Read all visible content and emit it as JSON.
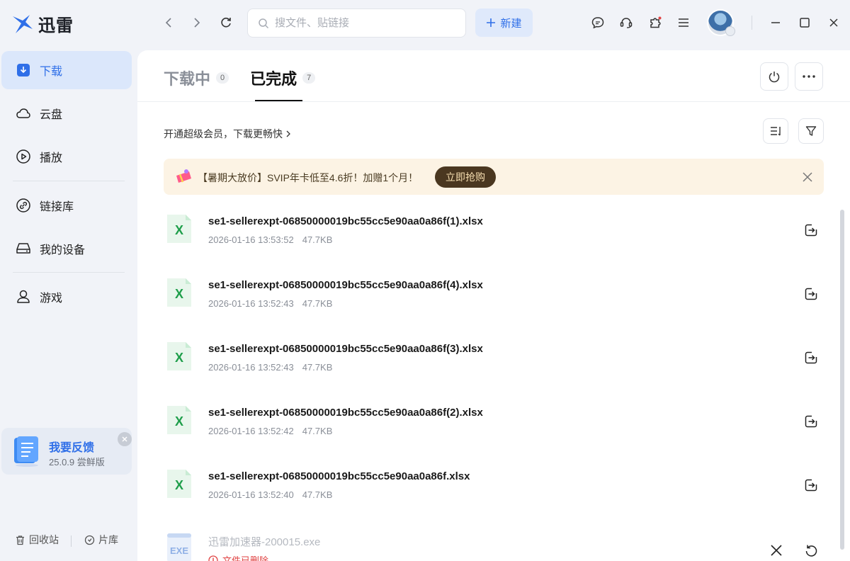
{
  "app": {
    "name": "迅雷"
  },
  "search": {
    "placeholder": "搜文件、贴链接"
  },
  "toolbar": {
    "new_label": "新建"
  },
  "sidebar": {
    "items": [
      {
        "label": "下载",
        "icon": "download-icon",
        "active": true
      },
      {
        "label": "云盘",
        "icon": "cloud-icon"
      },
      {
        "label": "播放",
        "icon": "play-icon"
      },
      {
        "label": "链接库",
        "icon": "link-icon"
      },
      {
        "label": "我的设备",
        "icon": "device-icon"
      },
      {
        "label": "游戏",
        "icon": "game-icon"
      }
    ],
    "feedback": {
      "title": "我要反馈",
      "version": "25.0.9 尝鲜版"
    },
    "bottom": {
      "recycle": "回收站",
      "library": "片库"
    }
  },
  "tabs": [
    {
      "label": "下载中",
      "count": "0"
    },
    {
      "label": "已完成",
      "count": "7",
      "active": true
    }
  ],
  "vip_link": "开通超级会员，下载更畅快",
  "promo": {
    "text": "【暑期大放价】SVIP年卡低至4.6折！加赠1个月！",
    "button": "立即抢购"
  },
  "files": [
    {
      "name": "se1-sellerexpt-06850000019bc55cc5e90aa0a86f(1).xlsx",
      "date": "2026-01-16 13:53:52",
      "size": "47.7KB"
    },
    {
      "name": "se1-sellerexpt-06850000019bc55cc5e90aa0a86f(4).xlsx",
      "date": "2026-01-16 13:52:43",
      "size": "47.7KB"
    },
    {
      "name": "se1-sellerexpt-06850000019bc55cc5e90aa0a86f(3).xlsx",
      "date": "2026-01-16 13:52:43",
      "size": "47.7KB"
    },
    {
      "name": "se1-sellerexpt-06850000019bc55cc5e90aa0a86f(2).xlsx",
      "date": "2026-01-16 13:52:42",
      "size": "47.7KB"
    },
    {
      "name": "se1-sellerexpt-06850000019bc55cc5e90aa0a86f.xlsx",
      "date": "2026-01-16 13:52:40",
      "size": "47.7KB"
    }
  ],
  "deleted_file": {
    "name": "迅雷加速器-200015.exe",
    "status": "文件已删除",
    "icon_label": "EXE"
  },
  "xlsx_icon_label": "X",
  "colors": {
    "accent": "#2f6fe8",
    "excel": "#1e9e4a",
    "promo_bg": "#fcf3e4",
    "danger": "#e04343"
  }
}
